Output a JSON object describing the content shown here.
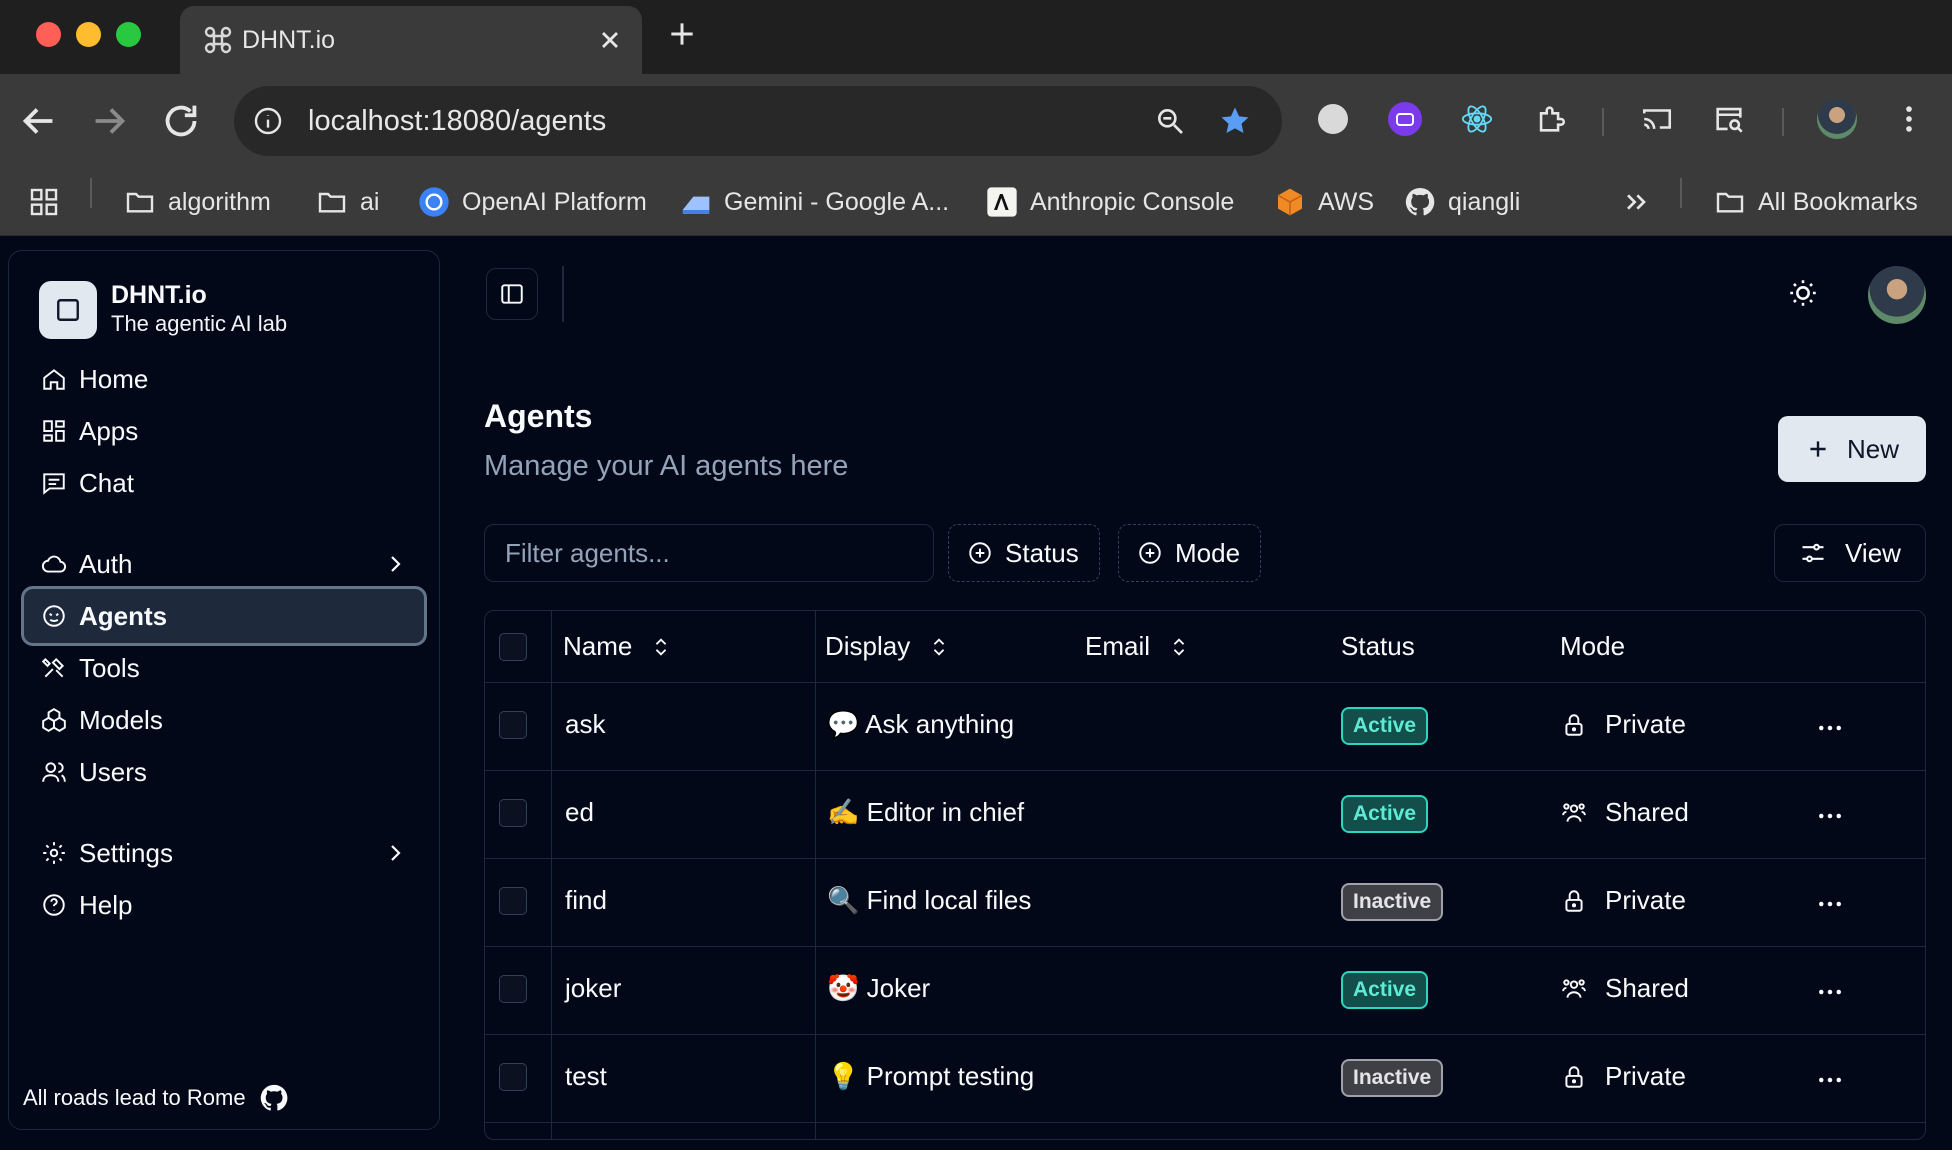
{
  "browser": {
    "tab_title": "DHNT.io",
    "url": "localhost:18080/agents",
    "bookmarks": [
      "algorithm",
      "ai",
      "OpenAI Platform",
      "Gemini - Google A...",
      "Anthropic Console",
      "AWS",
      "qiangli"
    ],
    "all_bookmarks": "All Bookmarks"
  },
  "sidebar": {
    "brand_name": "DHNT.io",
    "brand_tagline": "The agentic AI lab",
    "items": [
      {
        "label": "Home"
      },
      {
        "label": "Apps"
      },
      {
        "label": "Chat"
      },
      {
        "label": "Auth"
      },
      {
        "label": "Agents"
      },
      {
        "label": "Tools"
      },
      {
        "label": "Models"
      },
      {
        "label": "Users"
      },
      {
        "label": "Settings"
      },
      {
        "label": "Help"
      }
    ],
    "footer": "All roads lead to Rome"
  },
  "page": {
    "title": "Agents",
    "subtitle": "Manage your AI agents here",
    "new_label": "New",
    "filter_placeholder": "Filter agents...",
    "status_filter": "Status",
    "mode_filter": "Mode",
    "view_label": "View"
  },
  "table": {
    "columns": [
      "Name",
      "Display",
      "Email",
      "Status",
      "Mode"
    ],
    "rows": [
      {
        "name": "ask",
        "emoji": "💬",
        "display": "Ask anything",
        "email": "",
        "status": "Active",
        "mode": "Private"
      },
      {
        "name": "ed",
        "emoji": "✍️",
        "display": "Editor in chief",
        "email": "",
        "status": "Active",
        "mode": "Shared"
      },
      {
        "name": "find",
        "emoji": "🔍",
        "display": "Find local files",
        "email": "",
        "status": "Inactive",
        "mode": "Private"
      },
      {
        "name": "joker",
        "emoji": "🤡",
        "display": "Joker",
        "email": "",
        "status": "Active",
        "mode": "Shared"
      },
      {
        "name": "test",
        "emoji": "💡",
        "display": "Prompt testing",
        "email": "",
        "status": "Inactive",
        "mode": "Private"
      }
    ]
  },
  "colors": {
    "background": "#020817",
    "border": "#1e293b",
    "active_badge": "#2dd4bf",
    "inactive_badge": "#a1a1aa",
    "muted_text": "#94a3b8"
  }
}
